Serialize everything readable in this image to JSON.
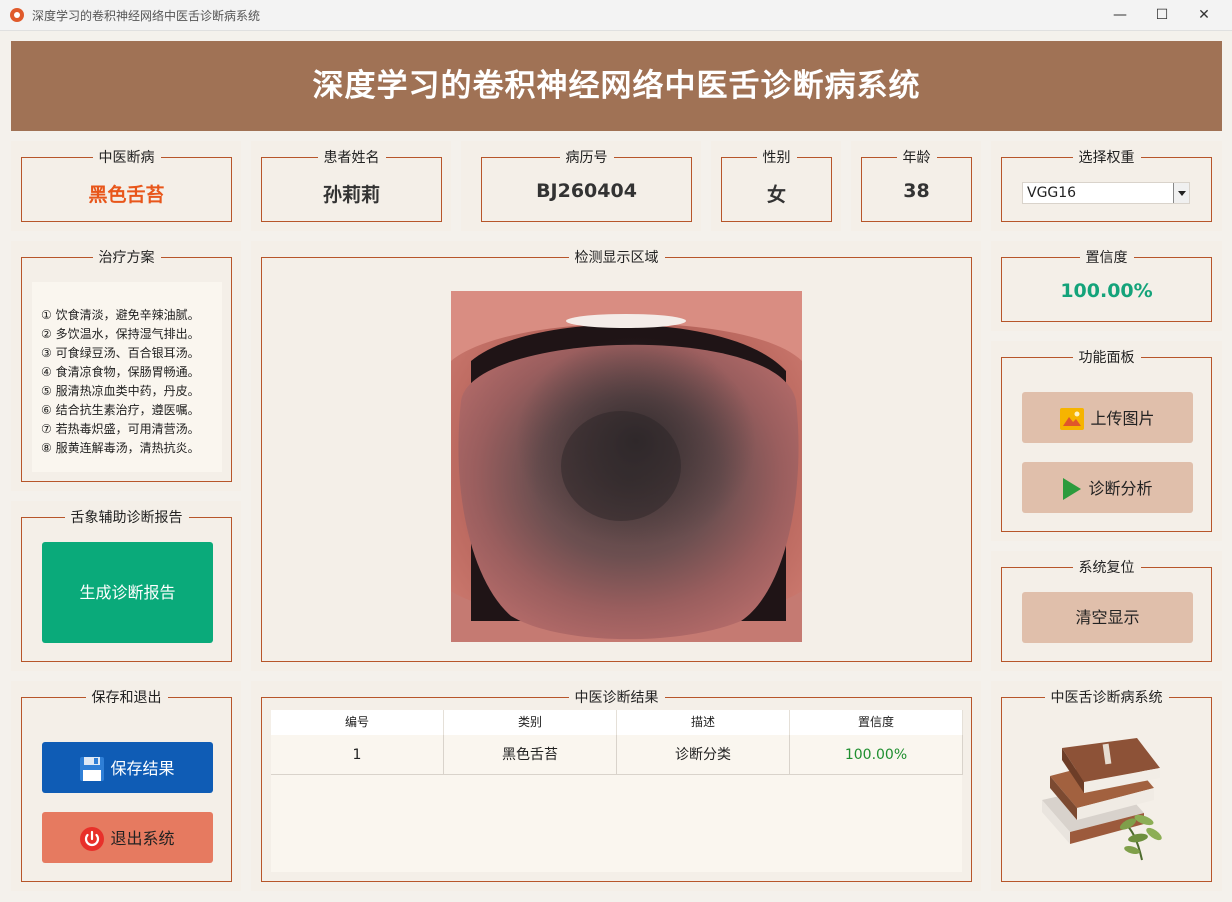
{
  "window": {
    "title": "深度学习的卷积神经网络中医舌诊断病系统",
    "minimize": "—",
    "maximize": "☐",
    "close": "✕"
  },
  "header": {
    "title": "深度学习的卷积神经网络中医舌诊断病系统"
  },
  "info": {
    "diagnosis": {
      "label": "中医断病",
      "value": "黑色舌苔"
    },
    "patient_name": {
      "label": "患者姓名",
      "value": "孙莉莉"
    },
    "record_no": {
      "label": "病历号",
      "value": "BJ260404"
    },
    "gender": {
      "label": "性别",
      "value": "女"
    },
    "age": {
      "label": "年龄",
      "value": "38"
    },
    "weights": {
      "label": "选择权重",
      "selected": "VGG16"
    }
  },
  "treatment": {
    "label": "治疗方案",
    "lines": [
      "① 饮食清淡，避免辛辣油腻。",
      "② 多饮温水，保持湿气排出。",
      "③ 可食绿豆汤、百合银耳汤。",
      "④ 食清凉食物，保肠胃畅通。",
      "⑤ 服清热凉血类中药，丹皮。",
      "⑥ 结合抗生素治疗，遵医嘱。",
      "⑦ 若热毒炽盛，可用清营汤。",
      "⑧ 服黄连解毒汤，清热抗炎。"
    ]
  },
  "report": {
    "label": "舌象辅助诊断报告",
    "button": "生成诊断报告"
  },
  "detection": {
    "label": "检测显示区域"
  },
  "confidence": {
    "label": "置信度",
    "value": "100.00%"
  },
  "functions": {
    "label": "功能面板",
    "upload": "上传图片",
    "analyze": "诊断分析"
  },
  "reset": {
    "label": "系统复位",
    "clear": "清空显示"
  },
  "save_exit": {
    "label": "保存和退出",
    "save": "保存结果",
    "exit": "退出系统"
  },
  "results": {
    "label": "中医诊断结果",
    "columns": [
      "编号",
      "类别",
      "描述",
      "置信度"
    ],
    "rows": [
      {
        "id": "1",
        "category": "黑色舌苔",
        "desc": "诊断分类",
        "conf": "100.00%"
      }
    ]
  },
  "brand": {
    "label": "中医舌诊断病系统"
  },
  "colors": {
    "header_bg": "#a07255",
    "accent_orange": "#e8561a",
    "confidence_green": "#14a37a",
    "report_btn": "#0aaa7a",
    "save_btn": "#0f5cb5",
    "exit_btn": "#e67a60",
    "func_btn": "#e0bfab",
    "border": "#b7552a"
  },
  "icons": {
    "upload": "image-icon",
    "analyze": "play-icon",
    "save": "floppy-icon",
    "exit": "power-icon"
  }
}
